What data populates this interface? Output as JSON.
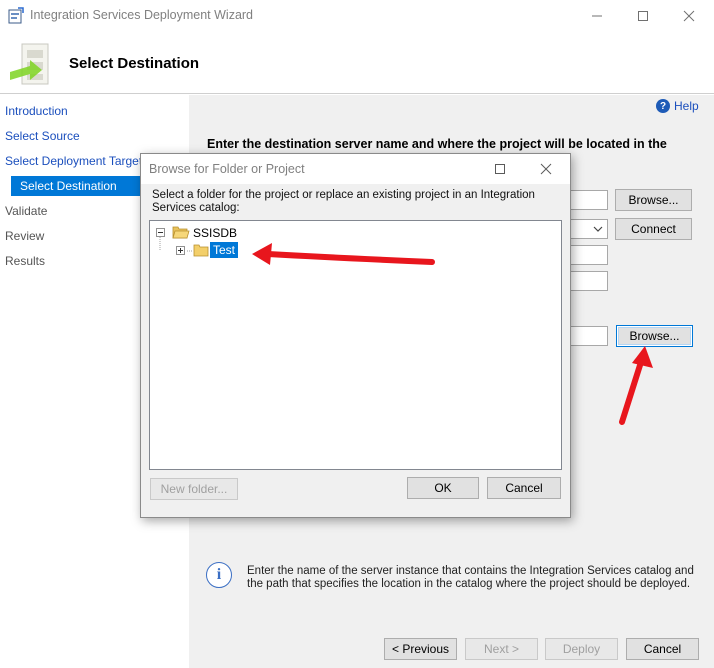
{
  "window": {
    "title": "Integration Services Deployment Wizard",
    "header_title": "Select Destination",
    "icons": {
      "app": "wizard-app-icon",
      "header": "deployment-destination-icon"
    }
  },
  "nav": {
    "items": [
      {
        "label": "Introduction",
        "state": "link"
      },
      {
        "label": "Select Source",
        "state": "link"
      },
      {
        "label": "Select Deployment Target",
        "state": "link"
      },
      {
        "label": "Select Destination",
        "state": "selected"
      },
      {
        "label": "Validate",
        "state": "pending"
      },
      {
        "label": "Review",
        "state": "pending"
      },
      {
        "label": "Results",
        "state": "pending"
      }
    ]
  },
  "content": {
    "help_label": "Help",
    "instruction": "Enter the destination server name and where the project will be located in the",
    "server_browse_label": "Browse...",
    "connect_label": "Connect",
    "path_browse_label": "Browse...",
    "info_text": "Enter the name of the server instance that contains the Integration Services catalog and the path that specifies the location in the catalog where the project should be deployed."
  },
  "footer": {
    "previous_label": "< Previous",
    "next_label": "Next >",
    "deploy_label": "Deploy",
    "cancel_label": "Cancel"
  },
  "dialog": {
    "title": "Browse for Folder or Project",
    "description": "Select a folder for the project or replace an existing project in an Integration Services catalog:",
    "tree": {
      "root": "SSISDB",
      "children": [
        {
          "label": "Test",
          "selected": true
        }
      ]
    },
    "new_folder_label": "New folder...",
    "ok_label": "OK",
    "cancel_label": "Cancel"
  },
  "colors": {
    "accent": "#0078d7",
    "annotation_arrow": "#e8161d",
    "link": "#1b4fbd",
    "content_background": "#f0f0f0"
  }
}
